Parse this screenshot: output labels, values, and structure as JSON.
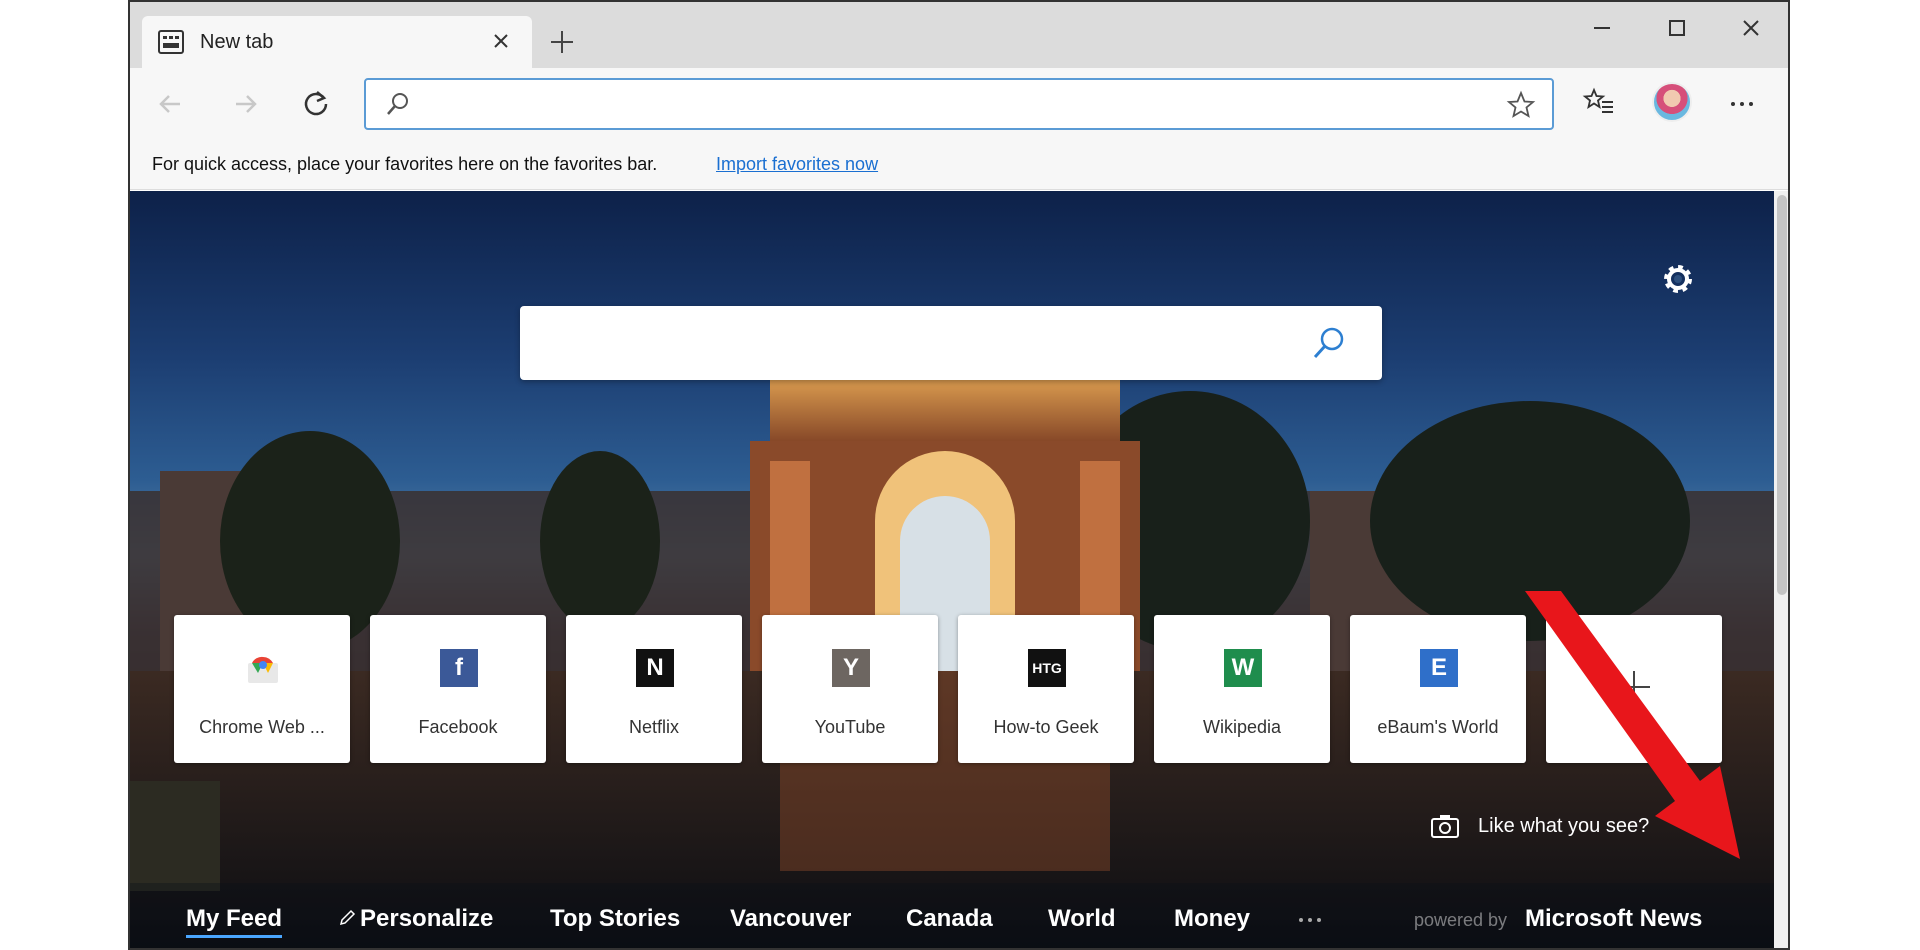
{
  "tab": {
    "title": "New tab"
  },
  "address_bar": {
    "value": "",
    "placeholder": ""
  },
  "favorites_bar": {
    "message": "For quick access, place your favorites here on the favorites bar.",
    "import_link": "Import favorites now"
  },
  "search": {
    "value": "",
    "placeholder": ""
  },
  "tiles": [
    {
      "label": "Chrome Web ...",
      "logo_text": "",
      "icon": "chrome-web-store-icon",
      "color": "#ffffff"
    },
    {
      "label": "Facebook",
      "logo_text": "f",
      "icon": "facebook-icon",
      "color": "#3b5998"
    },
    {
      "label": "Netflix",
      "logo_text": "N",
      "icon": "netflix-icon",
      "color": "#111111"
    },
    {
      "label": "YouTube",
      "logo_text": "Y",
      "icon": "youtube-icon",
      "color": "#6d6661"
    },
    {
      "label": "How-to Geek",
      "logo_text": "HTG",
      "icon": "howtogeek-icon",
      "color": "#111111"
    },
    {
      "label": "Wikipedia",
      "logo_text": "W",
      "icon": "wikipedia-icon",
      "color": "#1f8d4d"
    },
    {
      "label": "eBaum's World",
      "logo_text": "E",
      "icon": "ebaumsworld-icon",
      "color": "#2f6fc9"
    }
  ],
  "like_prompt": "Like what you see?",
  "feed_nav": {
    "items": [
      "My Feed",
      "Personalize",
      "Top Stories",
      "Vancouver",
      "Canada",
      "World",
      "Money"
    ],
    "powered_by": "powered by",
    "brand": "Microsoft News"
  },
  "colors": {
    "accent": "#5b9bd5",
    "link": "#1a6fd1",
    "annotation_arrow": "#e8161b"
  }
}
